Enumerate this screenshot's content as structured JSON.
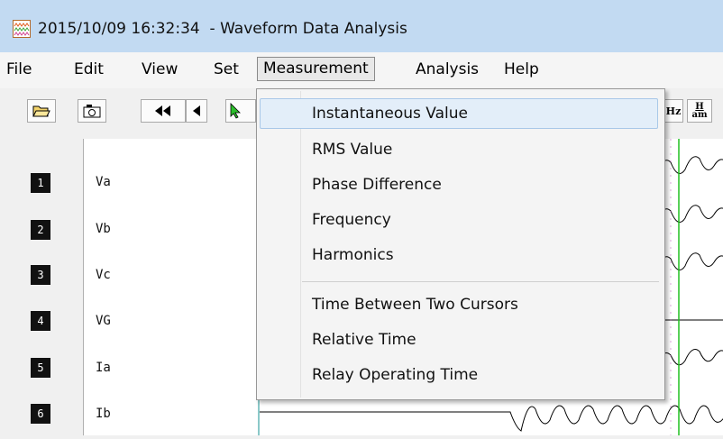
{
  "window": {
    "title": "2015/10/09 16:32:34  - Waveform Data Analysis",
    "icon": "waveform-app-icon"
  },
  "menubar": {
    "items": [
      "File",
      "Edit",
      "View",
      "Set",
      "Measurement",
      "Analysis",
      "Help"
    ],
    "active": "Measurement"
  },
  "toolbar": {
    "buttons": [
      "open-folder-icon",
      "camera-icon",
      "rewind-icon",
      "step-back-icon",
      "cursor-icon",
      "hz-icon",
      "harmonic-icon"
    ],
    "hz_label": "Hz",
    "harm_label_top": "H",
    "harm_label_bottom": "am"
  },
  "channels": [
    {
      "number": "1",
      "name": "Va"
    },
    {
      "number": "2",
      "name": "Vb"
    },
    {
      "number": "3",
      "name": "Vc"
    },
    {
      "number": "4",
      "name": "VG"
    },
    {
      "number": "5",
      "name": "Ia"
    },
    {
      "number": "6",
      "name": "Ib"
    }
  ],
  "dropdown": {
    "items": [
      "Instantaneous Value",
      "RMS Value",
      "Phase Difference",
      "Frequency",
      "Harmonics",
      "Time Between Two Cursors",
      "Relative Time",
      "Relay Operating Time"
    ],
    "highlighted": "Instantaneous Value"
  },
  "colors": {
    "cursor": "#22c022",
    "plot_border": "#8bc9c9",
    "highlight": "#e3eef9",
    "titlebar": "#c2daf2"
  }
}
